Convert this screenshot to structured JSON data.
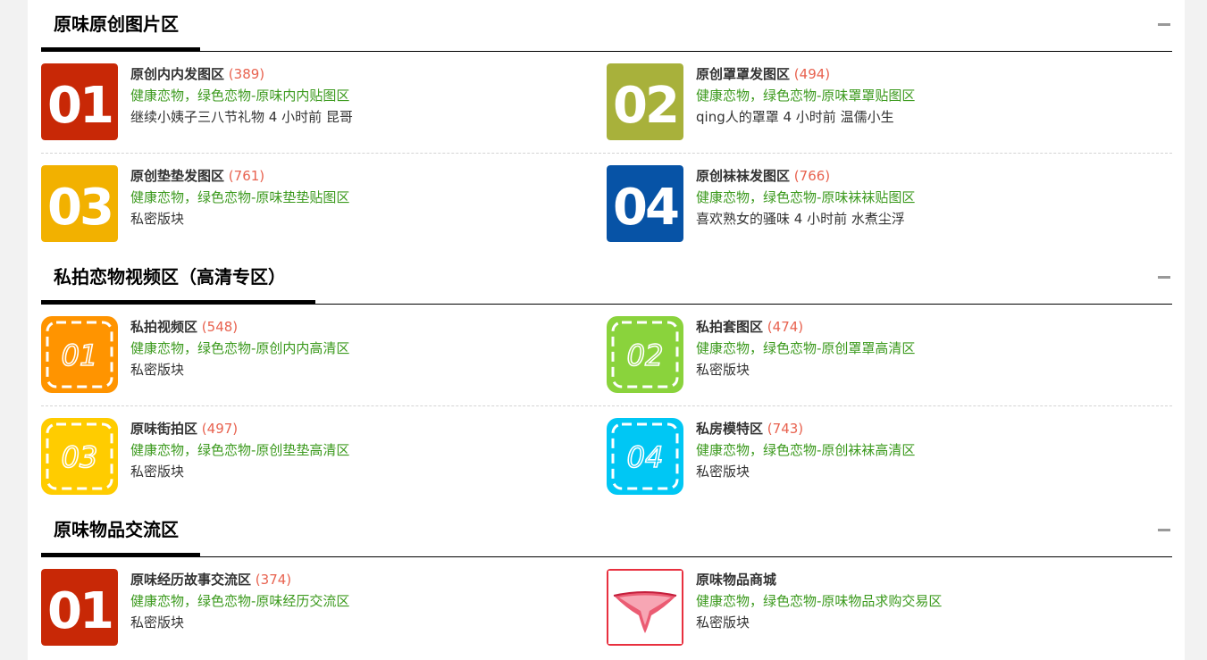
{
  "sections": [
    {
      "title": "原味原创图片区",
      "forums": [
        {
          "name": "原创内内发图区",
          "count": "(389)",
          "desc": "健康恋物，绿色恋物-原味内内贴图区",
          "last": "继续小姨子三八节礼物 4 小时前 昆哥",
          "badge": "01",
          "badge_style": "solid",
          "color": "#c82806"
        },
        {
          "name": "原创罩罩发图区",
          "count": "(494)",
          "desc": "健康恋物，绿色恋物-原味罩罩贴图区",
          "last": "qing人的罩罩 4 小时前 温儒小生",
          "badge": "02",
          "badge_style": "solid",
          "color": "#a8b13b"
        },
        {
          "name": "原创垫垫发图区",
          "count": "(761)",
          "desc": "健康恋物，绿色恋物-原味垫垫贴图区",
          "last": "私密版块",
          "badge": "03",
          "badge_style": "solid",
          "color": "#f2b100"
        },
        {
          "name": "原创袜袜发图区",
          "count": "(766)",
          "desc": "健康恋物，绿色恋物-原味袜袜贴图区",
          "last": "喜欢熟女的骚味 4 小时前 水煮尘浮",
          "badge": "04",
          "badge_style": "solid",
          "color": "#0753a6"
        }
      ]
    },
    {
      "title": "私拍恋物视频区（高清专区）",
      "forums": [
        {
          "name": "私拍视频区",
          "count": "(548)",
          "desc": "健康恋物，绿色恋物-原创内内高清区",
          "last": "私密版块",
          "badge": "01",
          "badge_style": "dashed",
          "color": "#ff9400"
        },
        {
          "name": "私拍套图区",
          "count": "(474)",
          "desc": "健康恋物，绿色恋物-原创罩罩高清区",
          "last": "私密版块",
          "badge": "02",
          "badge_style": "dashed",
          "color": "#8ad33c"
        },
        {
          "name": "原味街拍区",
          "count": "(497)",
          "desc": "健康恋物，绿色恋物-原创垫垫高清区",
          "last": "私密版块",
          "badge": "03",
          "badge_style": "dashed",
          "color": "#ffcc00"
        },
        {
          "name": "私房模特区",
          "count": "(743)",
          "desc": "健康恋物，绿色恋物-原创袜袜高清区",
          "last": "私密版块",
          "badge": "04",
          "badge_style": "dashed",
          "color": "#00c7f4"
        }
      ]
    },
    {
      "title": "原味物品交流区",
      "forums": [
        {
          "name": "原味经历故事交流区",
          "count": "(374)",
          "desc": "健康恋物，绿色恋物-原味经历交流区",
          "last": "私密版块",
          "badge": "01",
          "badge_style": "solid",
          "color": "#c82806"
        },
        {
          "name": "原味物品商城",
          "count": "",
          "desc": "健康恋物，绿色恋物-原味物品求购交易区",
          "last": "私密版块",
          "badge": "",
          "badge_style": "image",
          "color": "#e8303f"
        }
      ]
    }
  ]
}
